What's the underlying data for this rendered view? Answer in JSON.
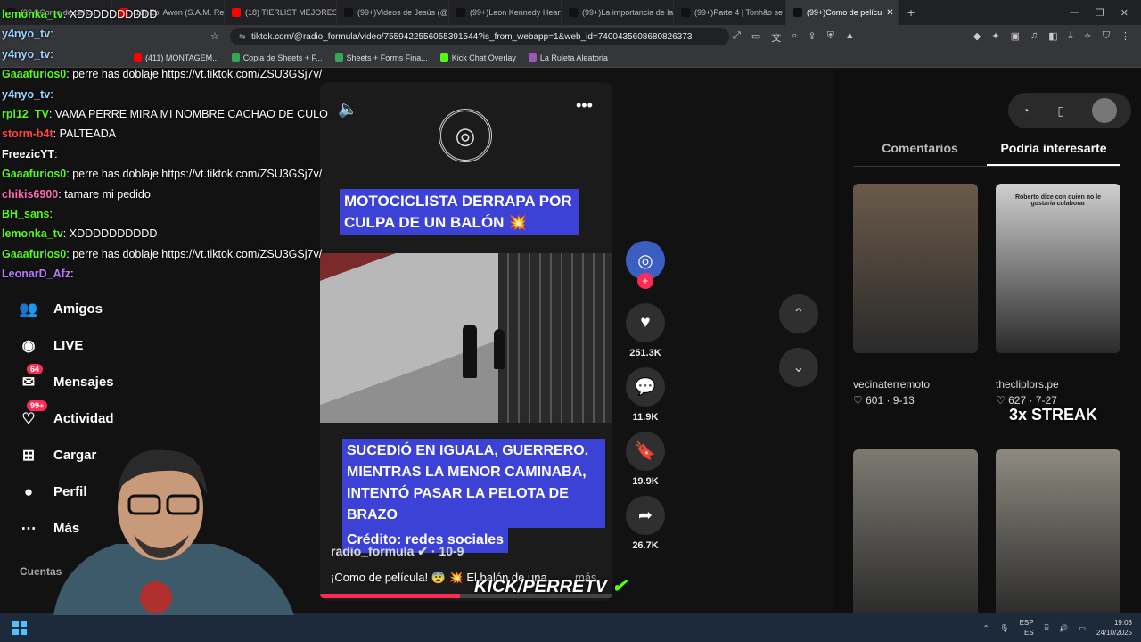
{
  "browser": {
    "tabs": [
      {
        "title": "(99+)Como de pelícu",
        "color": "#111111"
      },
      {
        "title": "(18) Ebi Awon (S.A.M. Rem",
        "color": "#ff0000"
      },
      {
        "title": "(18) TIERLIST MEJORES",
        "color": "#ff0000"
      },
      {
        "title": "(99+)Videos de Jesús (@r",
        "color": "#111111"
      },
      {
        "title": "(99+)Leon Kennedy Heartt",
        "color": "#111111"
      },
      {
        "title": "(99+)La importancia de la",
        "color": "#111111"
      },
      {
        "title": "(99+)Parte 4 | Tonhão se la",
        "color": "#111111"
      },
      {
        "title": "(99+)Como de pelícu",
        "color": "#111111"
      }
    ],
    "url": "tiktok.com/@radio_formula/video/7559422556055391544?is_from_webapp=1&web_id=7400435608680826373",
    "bookmarks": [
      "(411) MONTAGEM...",
      "Copia de Sheets + F...",
      "Sheets + Forms Fina...",
      "Kick Chat Overlay",
      "La Ruleta Aleatoria"
    ]
  },
  "chat": [
    {
      "user": "lemonka_tv",
      "color": "#53fc18",
      "text": "XDDDDDDDDDD"
    },
    {
      "user": "y4nyo_tv",
      "color": "#9bd3ff",
      "text": ""
    },
    {
      "user": "y4nyo_tv",
      "color": "#9bd3ff",
      "text": ""
    },
    {
      "user": "Gaaafurios0",
      "color": "#53fc18",
      "text": "perre has doblaje https://vt.tiktok.com/ZSU3GSj7v/"
    },
    {
      "user": "y4nyo_tv",
      "color": "#9bd3ff",
      "text": ""
    },
    {
      "user": "rpl12_TV",
      "color": "#53fc18",
      "text": "VAMA PERRE MIRA MI NOMBRE CACHAO DE CULO"
    },
    {
      "user": "storm-b4t",
      "color": "#ff4444",
      "text": "PALTEADA"
    },
    {
      "user": "FreezicYT",
      "color": "#ffffff",
      "text": ""
    },
    {
      "user": "Gaaafurios0",
      "color": "#53fc18",
      "text": "perre has doblaje https://vt.tiktok.com/ZSU3GSj7v/"
    },
    {
      "user": "chikis6900",
      "color": "#ff69b4",
      "text": "tamare mi pedido"
    },
    {
      "user": "BH_sans",
      "color": "#53fc18",
      "text": ""
    },
    {
      "user": "lemonka_tv",
      "color": "#53fc18",
      "text": "XDDDDDDDDDD"
    },
    {
      "user": "Gaaafurios0",
      "color": "#53fc18",
      "text": "perre has doblaje https://vt.tiktok.com/ZSU3GSj7v/"
    },
    {
      "user": "LeonarD_Afz",
      "color": "#b57bff",
      "text": ""
    }
  ],
  "nav": [
    {
      "label": "Amigos",
      "icon": "friends-icon",
      "glyph": "👥"
    },
    {
      "label": "LIVE",
      "icon": "live-icon",
      "glyph": "◉"
    },
    {
      "label": "Mensajes",
      "icon": "messages-icon",
      "glyph": "✉",
      "badge": "64"
    },
    {
      "label": "Actividad",
      "icon": "activity-icon",
      "glyph": "♡",
      "badge": "99+"
    },
    {
      "label": "Cargar",
      "icon": "upload-icon",
      "glyph": "⊞"
    },
    {
      "label": "Perfil",
      "icon": "profile-icon",
      "glyph": "●"
    },
    {
      "label": "Más",
      "icon": "more-icon",
      "glyph": "⋯"
    }
  ],
  "nav_section": "Cuentas",
  "video": {
    "caption1": "MOTOCICLISTA DERRAPA POR CULPA DE UN BALÓN 💥",
    "caption2": "SUCEDIÓ EN IGUALA, GUERRERO. MIENTRAS LA MENOR CAMINABA, INTENTÓ PASAR LA PELOTA DE BRAZO",
    "caption3": "Crédito: redes sociales",
    "author": "radio_formula ✔ · 10-9",
    "description": "¡Como de película! 😨 💥 El balón de una...",
    "more": "más",
    "progress": 0.48
  },
  "actions": [
    {
      "name": "like",
      "glyph": "♥",
      "count": "251.3K"
    },
    {
      "name": "comment",
      "glyph": "💬",
      "count": "11.9K"
    },
    {
      "name": "save",
      "glyph": "🔖",
      "count": "19.9K"
    },
    {
      "name": "share",
      "glyph": "➦",
      "count": "26.7K"
    }
  ],
  "right": {
    "tabs": [
      "Comentarios",
      "Podría interesarte"
    ],
    "items": [
      {
        "name": "vecinaterremoto",
        "stats": "♡ 601 · 9-13",
        "bg": "#6b5a4a",
        "overlay": ""
      },
      {
        "name": "thecliplors.pe",
        "stats": "♡ 627 · 7-27",
        "bg": "#cfcfcf",
        "overlay": "Roberto dice con quien no le gustaría colaborar"
      },
      {
        "name": "",
        "stats": "",
        "bg": "#7d7a72",
        "overlay": ""
      },
      {
        "name": "",
        "stats": "",
        "bg": "#8e8a80",
        "overlay": ""
      }
    ]
  },
  "overlay": {
    "kick": "KICK/PERRETV",
    "streak": "3x STREAK"
  },
  "tray": {
    "lang1": "ESP",
    "lang2": "ES",
    "time": "19:03",
    "date": "24/10/2025"
  }
}
